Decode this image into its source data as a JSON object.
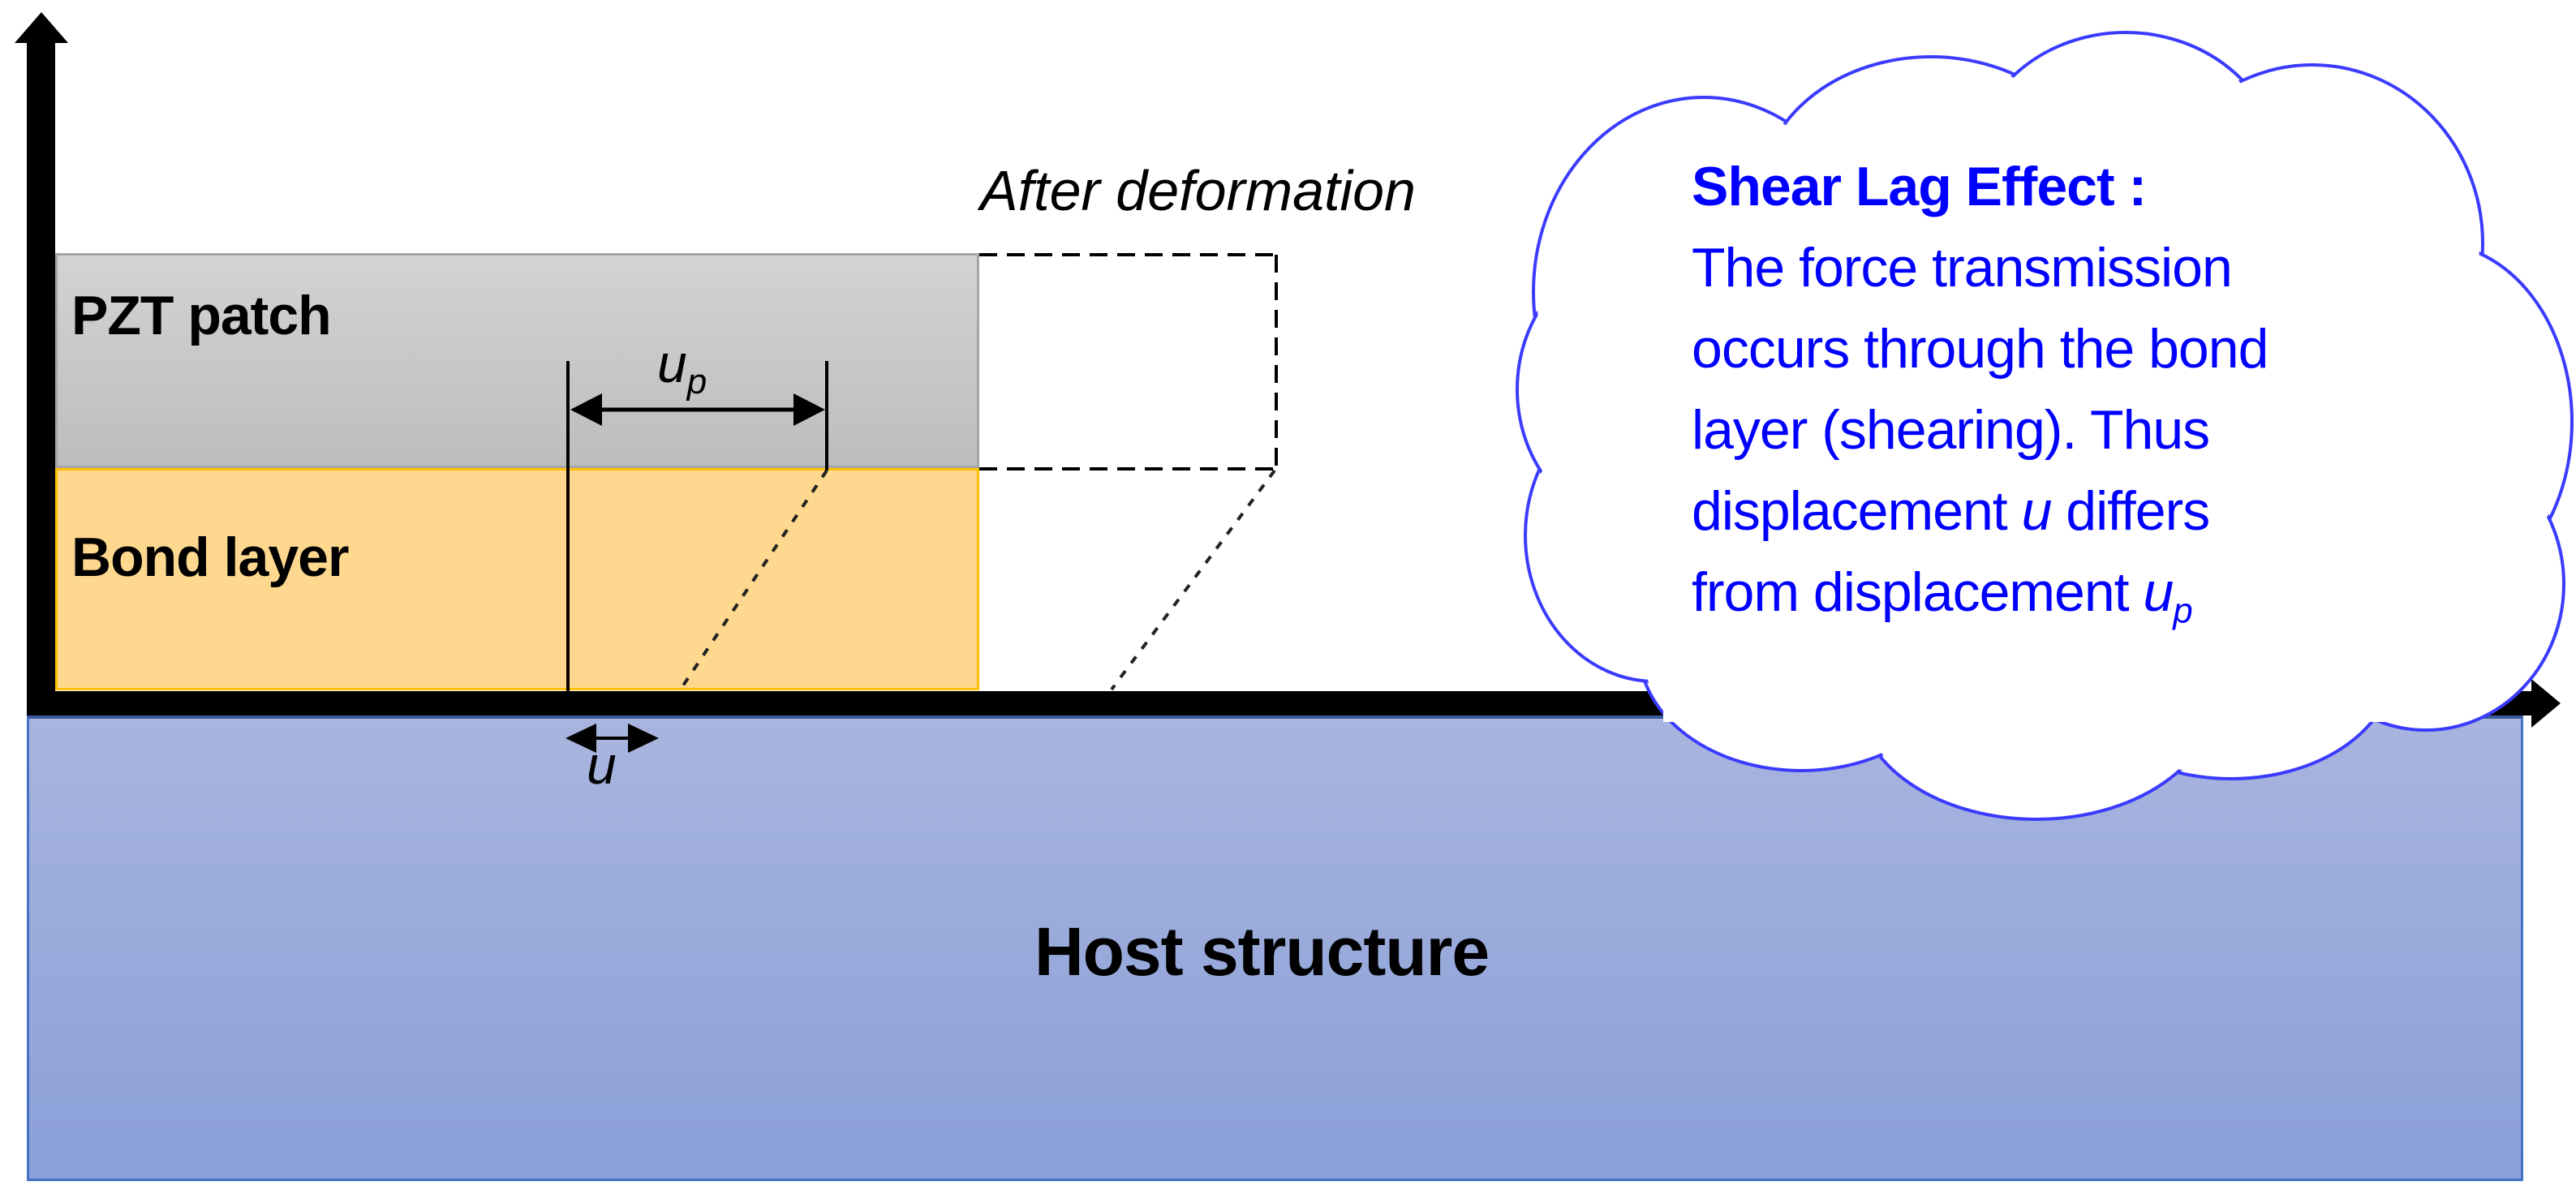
{
  "labels": {
    "pzt_patch": "PZT patch",
    "bond_layer": "Bond layer",
    "after_deformation": "After deformation",
    "host_structure": "Host structure",
    "u": "u",
    "up_base": "u",
    "up_sub": "p"
  },
  "callout": {
    "title": "Shear Lag Effect :",
    "lines": [
      "The force transmission",
      "occurs through  the bond",
      "layer (shearing). Thus"
    ],
    "line4_pre": "displacement ",
    "line4_var": "u",
    "line4_post": " differs",
    "line5_pre": "from displacement ",
    "line5_var": "u",
    "line5_sub": "p"
  },
  "colors": {
    "pzt_fill": "#c8c8c8",
    "bond_fill": "#fed88e",
    "bond_border": "#ffc000",
    "host_fill": "#9aabdb",
    "host_border": "#4472c4",
    "callout_text": "#0000ff",
    "cloud_stroke": "#3b3bff"
  }
}
